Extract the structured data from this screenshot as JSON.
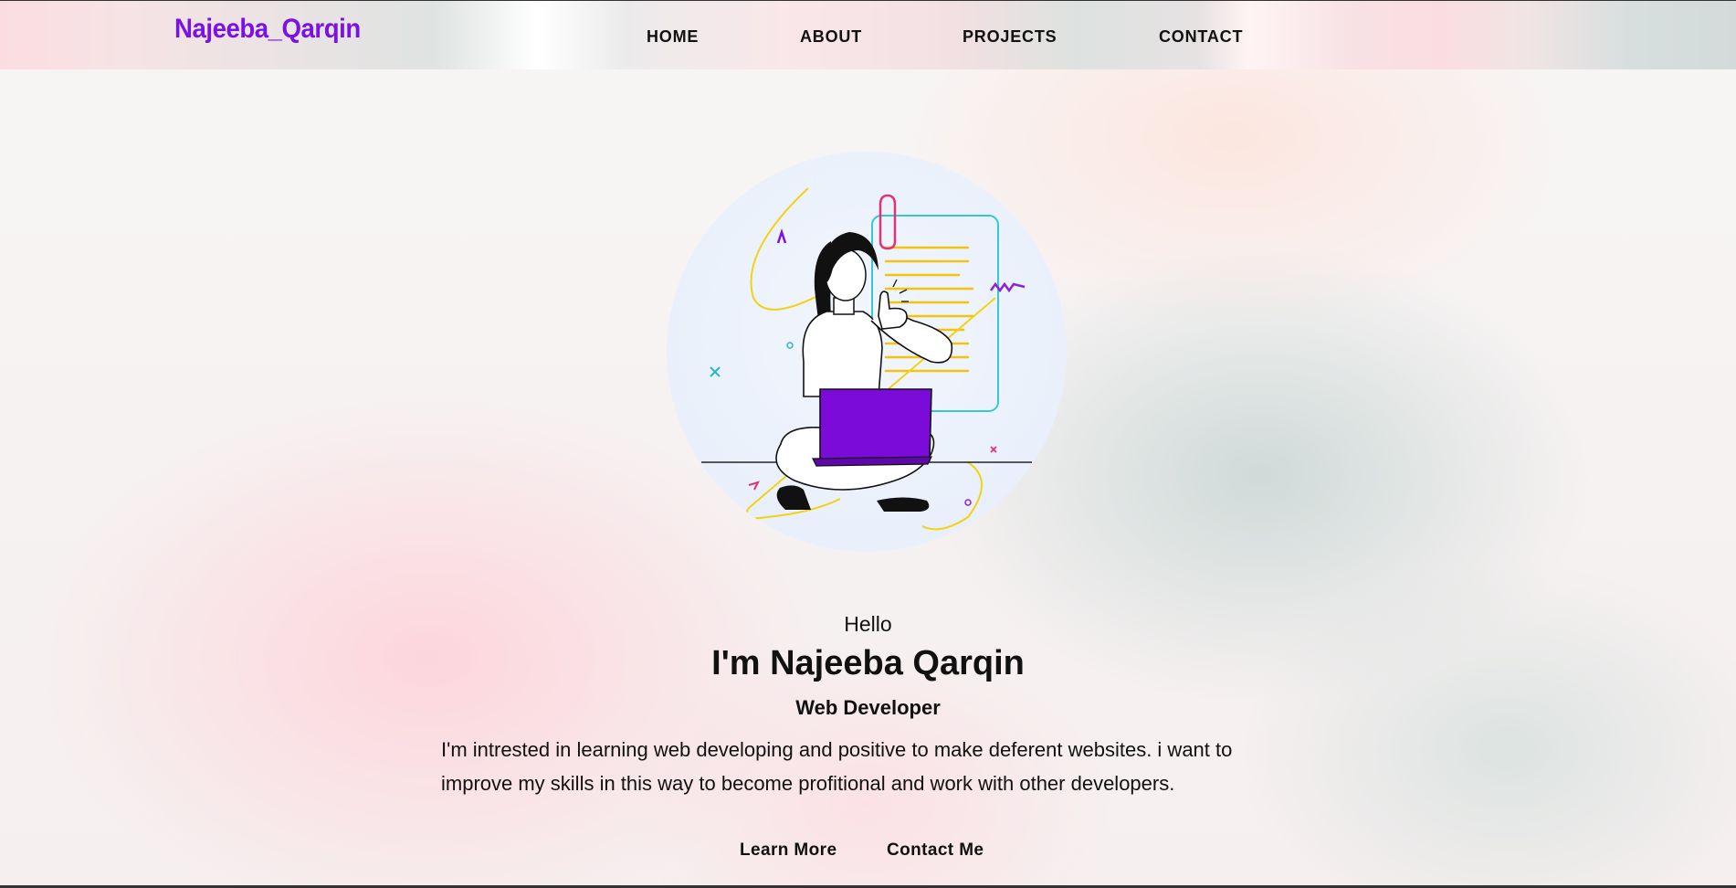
{
  "site": {
    "logo": "Najeeba_Qarqin",
    "accent_color": "#7a12e3"
  },
  "nav": {
    "items": [
      {
        "label": "HOME"
      },
      {
        "label": "ABOUT"
      },
      {
        "label": "PROJECTS"
      },
      {
        "label": "CONTACT"
      }
    ]
  },
  "hero": {
    "avatar_icon": "girl-with-laptop-illustration",
    "greeting": "Hello",
    "title": "I'm Najeeba Qarqin",
    "subtitle": "Web Developer",
    "bio_line1": "I'm intrested in learning web developing and positive to make deferent websites. i want to",
    "bio_line2": "improve my skills in this way to become profitional and work with other developers.",
    "learn_more_label": "Learn More",
    "contact_me_label": "Contact Me"
  }
}
